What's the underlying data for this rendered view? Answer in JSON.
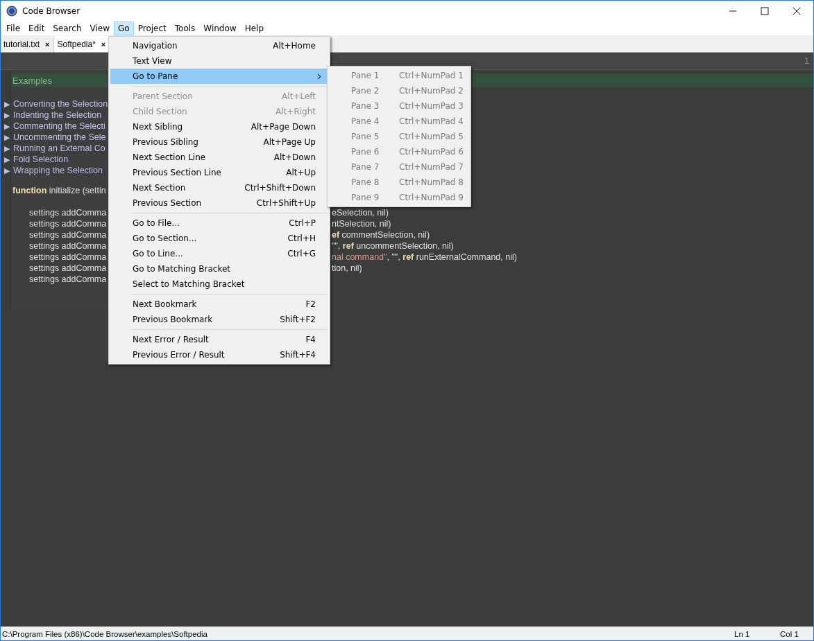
{
  "window": {
    "title": "Code Browser"
  },
  "menubar": [
    {
      "label": "File",
      "selected": false
    },
    {
      "label": "Edit",
      "selected": false
    },
    {
      "label": "Search",
      "selected": false
    },
    {
      "label": "View",
      "selected": false
    },
    {
      "label": "Go",
      "selected": true
    },
    {
      "label": "Project",
      "selected": false
    },
    {
      "label": "Tools",
      "selected": false
    },
    {
      "label": "Window",
      "selected": false
    },
    {
      "label": "Help",
      "selected": false
    }
  ],
  "tabs": [
    {
      "label": "tutorial.txt",
      "close": "×",
      "selected": false
    },
    {
      "label": "Softpedia*",
      "close": "×",
      "selected": true
    }
  ],
  "editor": {
    "line_indicator": "1",
    "section_title": "Examples",
    "outline": [
      {
        "marker": "▶",
        "text": "Converting the Selection"
      },
      {
        "marker": "▶",
        "text": "Indenting the Selection"
      },
      {
        "marker": "▶",
        "text": "Commenting the Selecti"
      },
      {
        "marker": "▶",
        "text": "Uncommenting the Sele"
      },
      {
        "marker": "▶",
        "text": "Running an External Co"
      },
      {
        "marker": "▶",
        "text": "Fold Selection"
      },
      {
        "marker": "▶",
        "text": "Wrapping the Selection"
      }
    ],
    "function_line": {
      "keyword": "function",
      "text": "initialize (settin"
    },
    "code_lines": [
      {
        "left": "settings addComma",
        "right": [
          {
            "kind": "plain",
            "text": "eSelection, nil)"
          }
        ]
      },
      {
        "left": "settings addComma",
        "right": [
          {
            "kind": "plain",
            "text": "ntSelection, nil)"
          }
        ]
      },
      {
        "left": "settings addComma",
        "right": [
          {
            "kind": "keyword",
            "text": "ef"
          },
          {
            "kind": "plain",
            "text": " commentSelection, nil)"
          }
        ]
      },
      {
        "left": "settings addComma",
        "right": [
          {
            "kind": "plain",
            "text": "\"\", "
          },
          {
            "kind": "keyword",
            "text": "ref"
          },
          {
            "kind": "plain",
            "text": " uncommentSelection, nil)"
          }
        ]
      },
      {
        "left": "settings addComma",
        "right": [
          {
            "kind": "string",
            "text": "nal command\""
          },
          {
            "kind": "plain",
            "text": ", \"\", "
          },
          {
            "kind": "keyword",
            "text": "ref"
          },
          {
            "kind": "plain",
            "text": " runExternalCommand, nil)"
          }
        ]
      },
      {
        "left": "settings addComma",
        "right": [
          {
            "kind": "plain",
            "text": "tion, nil)"
          }
        ]
      },
      {
        "left": "settings addComma"
      }
    ]
  },
  "go_menu": [
    {
      "kind": "item",
      "label": "Navigation",
      "shortcut": "Alt+Home",
      "disabled": false,
      "selected": false
    },
    {
      "kind": "item",
      "label": "Text View",
      "disabled": false,
      "selected": false
    },
    {
      "kind": "submenu",
      "label": "Go to Pane",
      "disabled": false,
      "selected": true
    },
    {
      "kind": "separator"
    },
    {
      "kind": "item",
      "label": "Parent Section",
      "shortcut": "Alt+Left",
      "disabled": true,
      "selected": false
    },
    {
      "kind": "item",
      "label": "Child Section",
      "shortcut": "Alt+Right",
      "disabled": true,
      "selected": false
    },
    {
      "kind": "item",
      "label": "Next Sibling",
      "shortcut": "Alt+Page Down",
      "disabled": false,
      "selected": false
    },
    {
      "kind": "item",
      "label": "Previous Sibling",
      "shortcut": "Alt+Page Up",
      "disabled": false,
      "selected": false
    },
    {
      "kind": "item",
      "label": "Next Section Line",
      "shortcut": "Alt+Down",
      "disabled": false,
      "selected": false
    },
    {
      "kind": "item",
      "label": "Previous Section Line",
      "shortcut": "Alt+Up",
      "disabled": false,
      "selected": false
    },
    {
      "kind": "item",
      "label": "Next Section",
      "shortcut": "Ctrl+Shift+Down",
      "disabled": false,
      "selected": false
    },
    {
      "kind": "item",
      "label": "Previous Section",
      "shortcut": "Ctrl+Shift+Up",
      "disabled": false,
      "selected": false
    },
    {
      "kind": "separator"
    },
    {
      "kind": "item",
      "label": "Go to File...",
      "shortcut": "Ctrl+P",
      "disabled": false,
      "selected": false
    },
    {
      "kind": "item",
      "label": "Go to Section...",
      "shortcut": "Ctrl+H",
      "disabled": false,
      "selected": false
    },
    {
      "kind": "item",
      "label": "Go to Line...",
      "shortcut": "Ctrl+G",
      "disabled": false,
      "selected": false
    },
    {
      "kind": "item",
      "label": "Go to Matching Bracket",
      "disabled": false,
      "selected": false
    },
    {
      "kind": "item",
      "label": "Select to Matching Bracket",
      "disabled": false,
      "selected": false
    },
    {
      "kind": "separator"
    },
    {
      "kind": "item",
      "label": "Next Bookmark",
      "shortcut": "F2",
      "disabled": false,
      "selected": false
    },
    {
      "kind": "item",
      "label": "Previous Bookmark",
      "shortcut": "Shift+F2",
      "disabled": false,
      "selected": false
    },
    {
      "kind": "separator"
    },
    {
      "kind": "item",
      "label": "Next Error / Result",
      "shortcut": "F4",
      "disabled": false,
      "selected": false
    },
    {
      "kind": "item",
      "label": "Previous Error / Result",
      "shortcut": "Shift+F4",
      "disabled": false,
      "selected": false
    }
  ],
  "pane_submenu": [
    {
      "label": "Pane 1",
      "shortcut": "Ctrl+NumPad 1",
      "disabled": true
    },
    {
      "label": "Pane 2",
      "shortcut": "Ctrl+NumPad 2",
      "disabled": true
    },
    {
      "label": "Pane 3",
      "shortcut": "Ctrl+NumPad 3",
      "disabled": true
    },
    {
      "label": "Pane 4",
      "shortcut": "Ctrl+NumPad 4",
      "disabled": true
    },
    {
      "label": "Pane 5",
      "shortcut": "Ctrl+NumPad 5",
      "disabled": true
    },
    {
      "label": "Pane 6",
      "shortcut": "Ctrl+NumPad 6",
      "disabled": true
    },
    {
      "label": "Pane 7",
      "shortcut": "Ctrl+NumPad 7",
      "disabled": true
    },
    {
      "label": "Pane 8",
      "shortcut": "Ctrl+NumPad 8",
      "disabled": true
    },
    {
      "label": "Pane 9",
      "shortcut": "Ctrl+NumPad 9",
      "disabled": true
    }
  ],
  "status_bar": {
    "path": "C:\\Program Files (x86)\\Code Browser\\examples\\Softpedia",
    "line": "Ln 1",
    "column": "Col 1"
  }
}
